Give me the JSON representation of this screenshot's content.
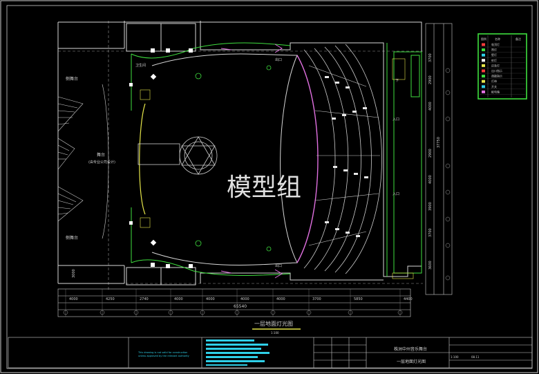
{
  "drawing": {
    "title": "一层地面灯光图",
    "scale": "1:100",
    "watermark": "模型组",
    "labels": {
      "stage_wing_top": "侧舞台",
      "stage_wing_bottom": "侧舞台",
      "stage_main": "舞台",
      "stage_main_note": "(由专业公司设计)",
      "toilet": "卫生间",
      "exit_top": "出口",
      "exit_bottom": "出口",
      "entrance_top": "入口",
      "entrance_bottom": "入口",
      "down_mark": "下"
    },
    "dims_bottom": [
      "4000",
      "4250",
      "2740",
      "4000",
      "4000",
      "4000",
      "4000",
      "3700",
      "5850",
      "4400"
    ],
    "dim_total": "65540",
    "dims_right": [
      "3700",
      "2900",
      "4000",
      "2900",
      "4000",
      "3900",
      "3700",
      "3600"
    ],
    "dim_right_mid": "37750",
    "dim_left": "3000"
  },
  "legend": {
    "header": [
      "图例",
      "名称",
      "备注"
    ],
    "rows": [
      "吸顶灯",
      "筒灯",
      "壁灯",
      "射灯",
      "应急灯",
      "出口指示",
      "疏散指示",
      "灯带",
      "开关",
      "配电箱"
    ]
  },
  "title_block": {
    "project": "株洲中州音乐舞台",
    "drawing_name": "一层地面灯光图",
    "scale": "1:100",
    "date": "08.11",
    "note_lines": [
      "This drawing is not valid for construction",
      "unless approved by the relevant authority"
    ]
  }
}
